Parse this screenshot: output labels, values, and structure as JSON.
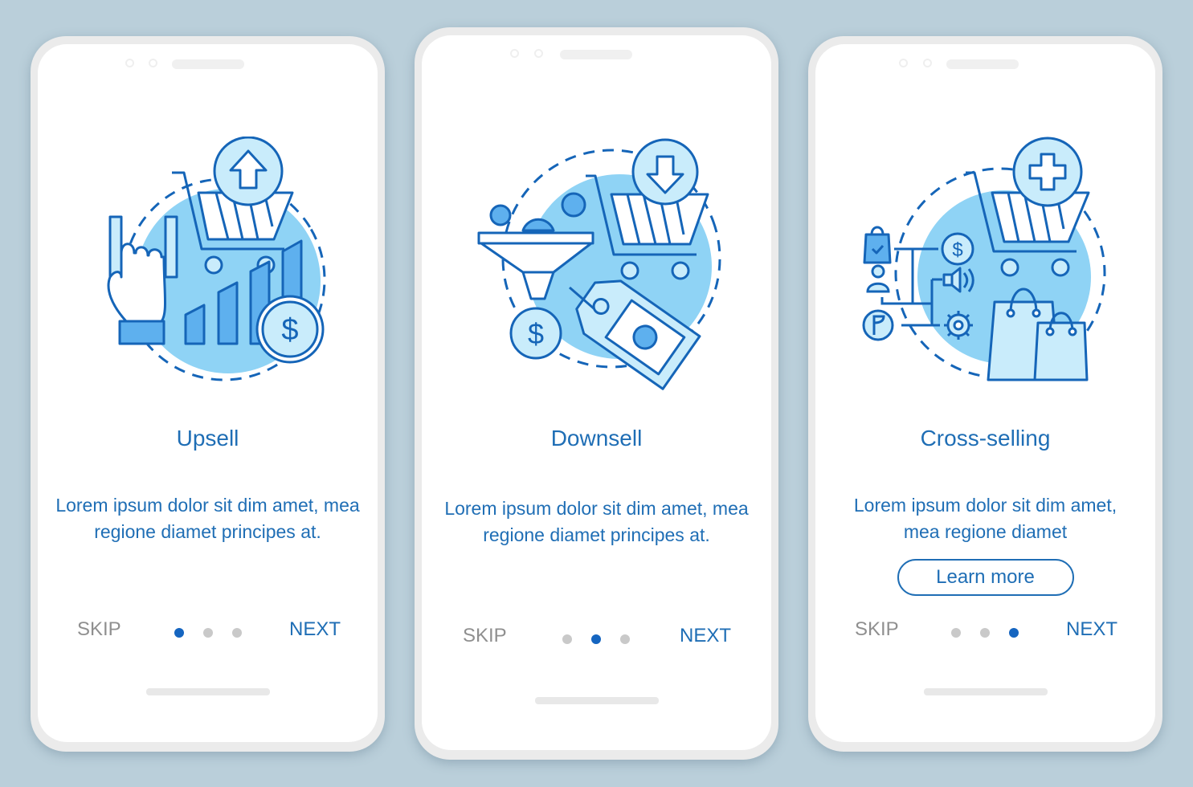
{
  "theme": {
    "background": "#bacfda",
    "accent": "#1f6eb5",
    "stroke": "#1565b8",
    "fill_mid": "#5eb0ee",
    "fill_light": "#c9ecfb",
    "fill_circle": "#8fd3f5",
    "inactive_dot": "#c9c9c9",
    "skip_color": "#8f8f8f"
  },
  "screens": [
    {
      "title": "Upsell",
      "illustration": "upsell-illustration",
      "description": "Lorem ipsum dolor sit dim amet, mea regione diamet principes at.",
      "skip_label": "SKIP",
      "next_label": "NEXT",
      "page_index": 1,
      "page_count": 3
    },
    {
      "title": "Downsell",
      "illustration": "downsell-illustration",
      "description": "Lorem ipsum dolor sit dim amet, mea regione diamet principes at.",
      "skip_label": "SKIP",
      "next_label": "NEXT",
      "page_index": 2,
      "page_count": 3
    },
    {
      "title": "Cross-selling",
      "illustration": "cross-selling-illustration",
      "description": "Lorem ipsum dolor sit dim amet, mea regione diamet",
      "button_label": "Learn more",
      "skip_label": "SKIP",
      "next_label": "NEXT",
      "page_index": 3,
      "page_count": 3
    }
  ]
}
